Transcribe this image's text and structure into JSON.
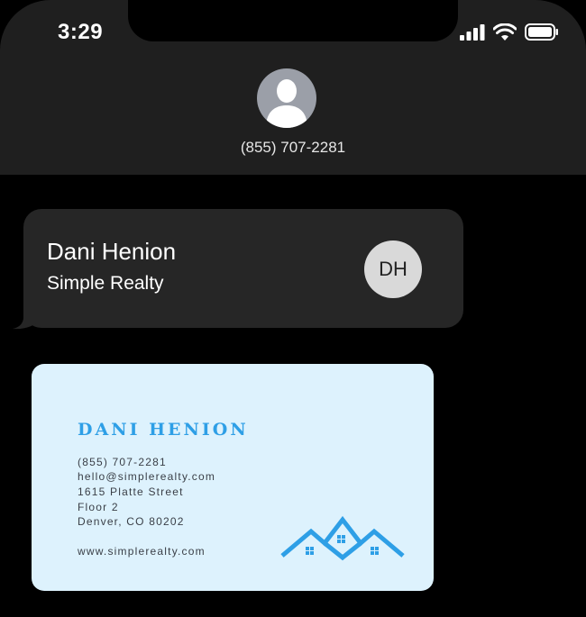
{
  "status_bar": {
    "time": "3:29",
    "icons": [
      "cellular-signal-icon",
      "wifi-icon",
      "battery-icon"
    ]
  },
  "header": {
    "avatar_icon": "person-silhouette-icon",
    "phone_number": "(855) 707-2281"
  },
  "contact_bubble": {
    "name": "Dani Henion",
    "company": "Simple Realty",
    "initials": "DH"
  },
  "business_card": {
    "name": "DANI HENION",
    "phone": "(855) 707-2281",
    "email": "hello@simplerealty.com",
    "address_line1": "1615 Platte Street",
    "address_line2": "Floor 2",
    "city_state_zip": "Denver, CO 80202",
    "website": "www.simplerealty.com",
    "logo_icon": "houses-roofline-icon"
  },
  "colors": {
    "header_bg": "#1f1f1f",
    "bubble_bg": "#262626",
    "card_bg": "#ddf2fd",
    "brand_blue": "#2e9fe6"
  }
}
